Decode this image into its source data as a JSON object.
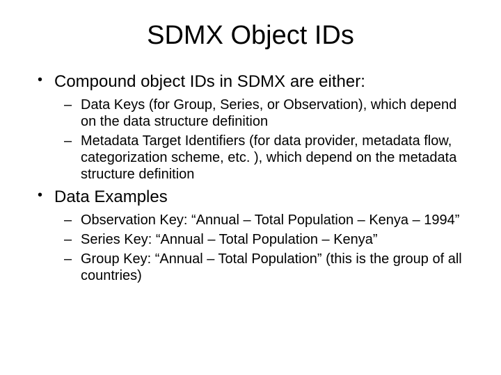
{
  "title": "SDMX Object IDs",
  "bullets": [
    {
      "text": "Compound object IDs in SDMX are either:",
      "children": [
        "Data Keys (for Group, Series, or Observation), which depend on the data structure definition",
        "Metadata Target Identifiers (for data provider, metadata flow, categorization scheme, etc. ), which depend on the metadata structure definition"
      ]
    },
    {
      "text": "Data Examples",
      "children": [
        "Observation Key: “Annual – Total Population – Kenya – 1994”",
        "Series Key: “Annual – Total Population – Kenya”",
        "Group Key: “Annual – Total Population” (this is the group of all countries)"
      ]
    }
  ]
}
